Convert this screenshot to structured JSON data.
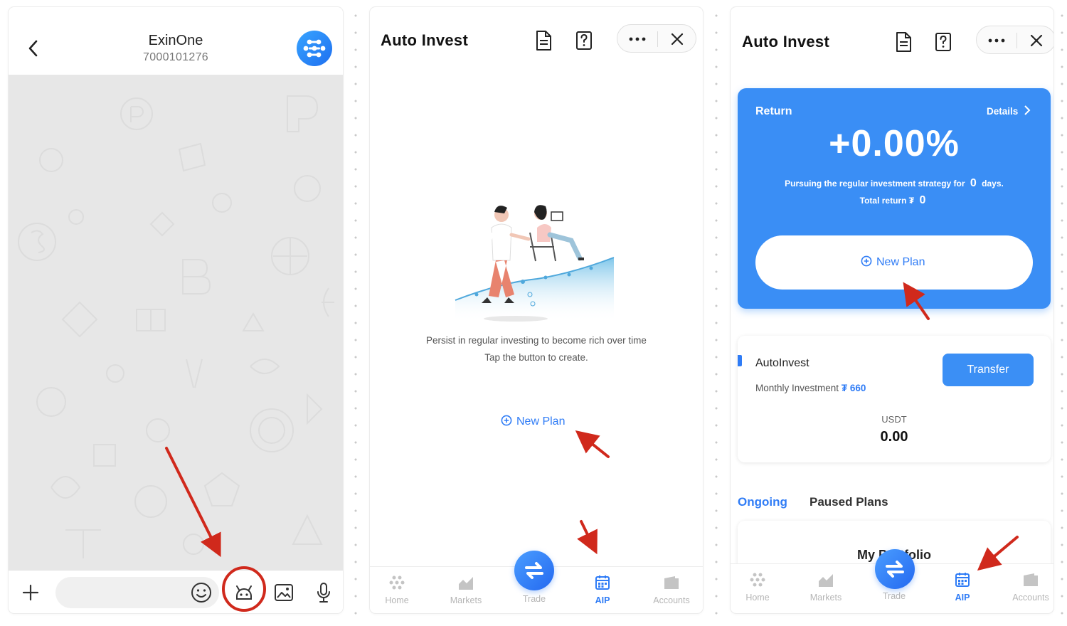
{
  "chat": {
    "title": "ExinOne",
    "subtitle": "7000101276"
  },
  "screen2": {
    "title": "Auto Invest",
    "empty_line1": "Persist in regular investing to become rich over time",
    "empty_line2": "Tap the button to create.",
    "new_plan": "New Plan"
  },
  "screen3": {
    "title": "Auto Invest",
    "return_label": "Return",
    "details_label": "Details",
    "return_value": "+0.00%",
    "strategy_prefix": "Pursuing the regular investment strategy for",
    "strategy_days": "0",
    "strategy_suffix": "days.",
    "total_return_label": "Total return ₮",
    "total_return_value": "0",
    "new_plan": "New Plan",
    "plan_name": "AutoInvest",
    "monthly_label": "Monthly Investment",
    "monthly_amount": "₮ 660",
    "transfer": "Transfer",
    "unit": "USDT",
    "balance": "0.00",
    "tab_ongoing": "Ongoing",
    "tab_paused": "Paused Plans",
    "portfolio_title": "My Portfolio"
  },
  "nav": {
    "home": "Home",
    "markets": "Markets",
    "trade": "Trade",
    "aip": "AIP",
    "accounts": "Accounts"
  },
  "colors": {
    "accent": "#2f7cf6",
    "card_blue": "#3a8ef5",
    "annotation_red": "#d0291c",
    "chat_bg": "#e7e7e7"
  }
}
